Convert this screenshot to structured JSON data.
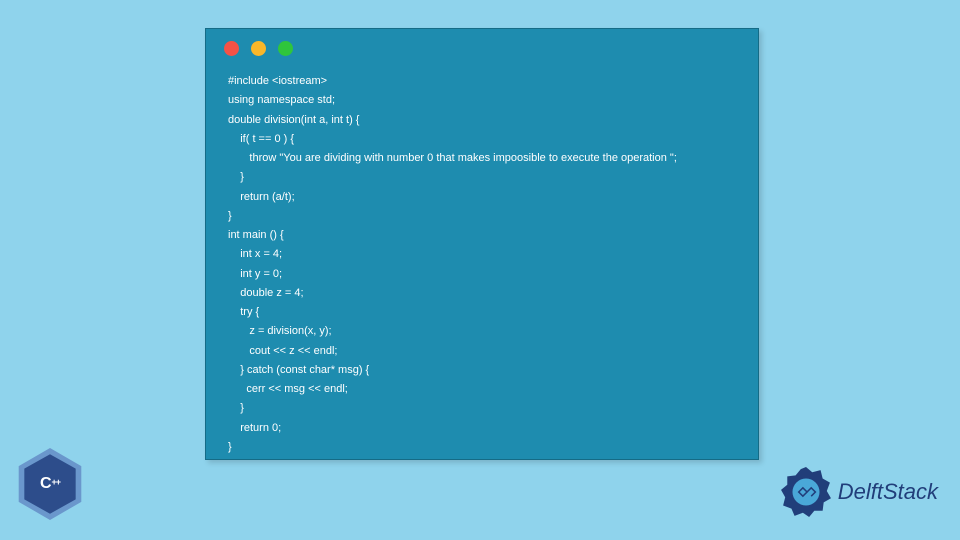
{
  "code": {
    "lines": [
      "#include <iostream>",
      "using namespace std;",
      "double division(int a, int t) {",
      "    if( t == 0 ) {",
      "       throw \"You are dividing with number 0 that makes impoosible to execute the operation \";",
      "    }",
      "    return (a/t);",
      "}",
      "int main () {",
      "    int x = 4;",
      "    int y = 0;",
      "    double z = 4;",
      "    try {",
      "       z = division(x, y);",
      "       cout << z << endl;",
      "    } catch (const char* msg) {",
      "      cerr << msg << endl;",
      "    }",
      "    return 0;",
      "}"
    ]
  },
  "badges": {
    "cpp": "C",
    "cpp_plus": "++",
    "brand": "DelftStack"
  },
  "colors": {
    "page_bg": "#8fd3ec",
    "window_bg": "#1e8caf",
    "dot_red": "#f55246",
    "dot_yellow": "#f9b72a",
    "dot_green": "#2fc53c",
    "brand_blue": "#213e7a"
  }
}
